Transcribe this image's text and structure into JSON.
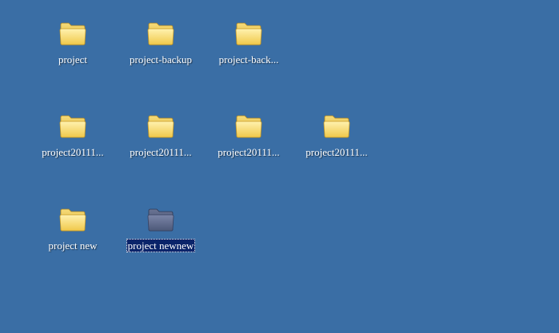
{
  "desktop": {
    "background_color": "#3a6ea5",
    "folder_color": "#f5d96a",
    "selected_folder_color": "#5c6a8a",
    "selection_highlight": "#0a246a",
    "icons": [
      {
        "label": "project",
        "icon": "folder-icon",
        "selected": false
      },
      {
        "label": "project-backup",
        "icon": "folder-icon",
        "selected": false
      },
      {
        "label": "project-back...",
        "icon": "folder-icon",
        "selected": false
      },
      {
        "label": "project20111...",
        "icon": "folder-icon",
        "selected": false
      },
      {
        "label": "project20111...",
        "icon": "folder-icon",
        "selected": false
      },
      {
        "label": "project20111...",
        "icon": "folder-icon",
        "selected": false
      },
      {
        "label": "project20111...",
        "icon": "folder-icon",
        "selected": false
      },
      {
        "label": "project new",
        "icon": "folder-icon",
        "selected": false
      },
      {
        "label": "project newnew",
        "icon": "folder-icon",
        "selected": true
      }
    ]
  }
}
